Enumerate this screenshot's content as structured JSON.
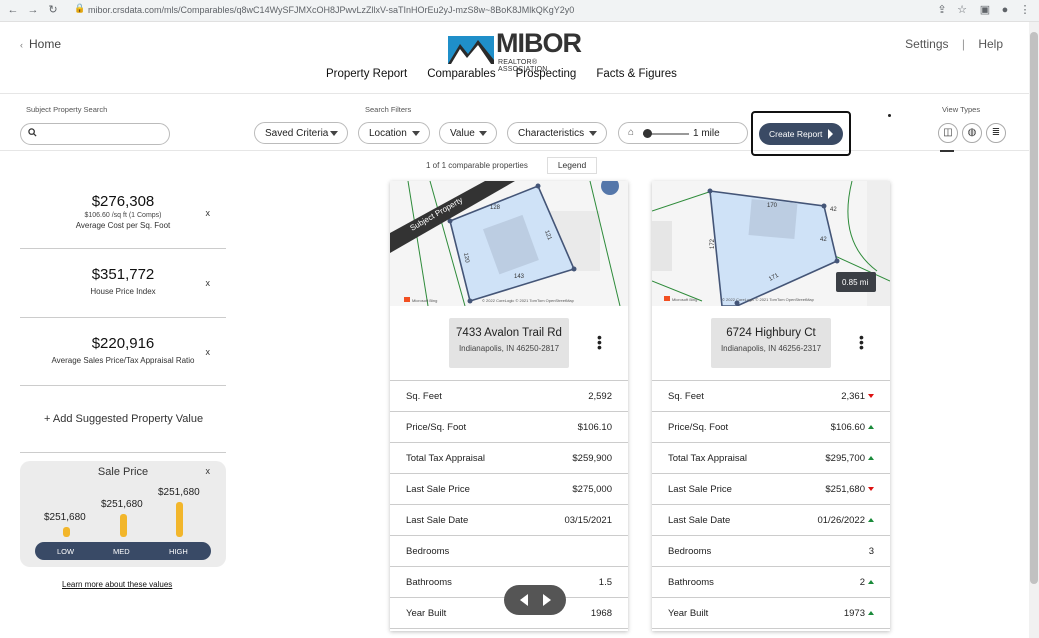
{
  "browser": {
    "url": "mibor.crsdata.com/mls/Comparables/q8wC14WySFJMXcOH8JPwvLzZllxV-saTInHOrEu2yJ-mzS8w~8BoK8JMlkQKgY2y0"
  },
  "header": {
    "home": "Home",
    "logo_text": "MIBOR",
    "logo_sub": "REALTOR® ASSOCIATION",
    "settings": "Settings",
    "separator": "|",
    "help": "Help",
    "nav": [
      "Property Report",
      "Comparables",
      "Prospecting",
      "Facts & Figures"
    ]
  },
  "filters": {
    "subject_label": "Subject Property Search",
    "search_placeholder": "",
    "search_filters_label": "Search Filters",
    "saved_criteria": "Saved Criteria",
    "location": "Location",
    "value": "Value",
    "characteristics": "Characteristics",
    "distance": "1 mile",
    "create_report": "Create Report",
    "view_types_label": "View Types"
  },
  "stats": [
    {
      "value": "$276,308",
      "sub": "$106.60 /sq ft (1 Comps)",
      "label": "Average Cost per Sq. Foot"
    },
    {
      "value": "$351,772",
      "sub": "",
      "label": "House Price Index"
    },
    {
      "value": "$220,916",
      "sub": "",
      "label": "Average Sales Price/Tax Appraisal Ratio"
    }
  ],
  "close_mark": "x",
  "add_value": "+  Add Suggested Property Value",
  "sale_price": {
    "title": "Sale Price",
    "low": "$251,680",
    "med": "$251,680",
    "high": "$251,680",
    "low_label": "LOW",
    "med_label": "MED",
    "high_label": "HIGH"
  },
  "learn_more": "Learn more about these values",
  "comparables": {
    "count": "1 of 1 comparable properties",
    "legend": "Legend"
  },
  "cards": [
    {
      "map_tag": "Subject Property",
      "lot_labels": [
        "128",
        "121",
        "120",
        "143"
      ],
      "address": "7433 Avalon Trail Rd",
      "city": "Indianapolis, IN 46250-2817",
      "rows": [
        {
          "k": "Sq. Feet",
          "v": "2,592",
          "t": ""
        },
        {
          "k": "Price/Sq. Foot",
          "v": "$106.10",
          "t": ""
        },
        {
          "k": "Total Tax Appraisal",
          "v": "$259,900",
          "t": ""
        },
        {
          "k": "Last Sale Price",
          "v": "$275,000",
          "t": ""
        },
        {
          "k": "Last Sale Date",
          "v": "03/15/2021",
          "t": ""
        },
        {
          "k": "Bedrooms",
          "v": "",
          "t": ""
        },
        {
          "k": "Bathrooms",
          "v": "1.5",
          "t": ""
        },
        {
          "k": "Year Built",
          "v": "1968",
          "t": ""
        }
      ]
    },
    {
      "map_tag": "0.85 mi",
      "lot_labels": [
        "170",
        "42",
        "42",
        "172",
        "171"
      ],
      "address": "6724 Highbury Ct",
      "city": "Indianapolis, IN 46256-2317",
      "rows": [
        {
          "k": "Sq. Feet",
          "v": "2,361",
          "t": "down"
        },
        {
          "k": "Price/Sq. Foot",
          "v": "$106.60",
          "t": "up"
        },
        {
          "k": "Total Tax Appraisal",
          "v": "$295,700",
          "t": "up"
        },
        {
          "k": "Last Sale Price",
          "v": "$251,680",
          "t": "down"
        },
        {
          "k": "Last Sale Date",
          "v": "01/26/2022",
          "t": "up"
        },
        {
          "k": "Bedrooms",
          "v": "3",
          "t": ""
        },
        {
          "k": "Bathrooms",
          "v": "2",
          "t": "up"
        },
        {
          "k": "Year Built",
          "v": "1973",
          "t": "up"
        }
      ]
    }
  ],
  "map_attribution": {
    "brand": "Microsoft Bing",
    "credit": "© 2022 CoreLogic  © 2021 TomTom  OpenStreetMap"
  }
}
